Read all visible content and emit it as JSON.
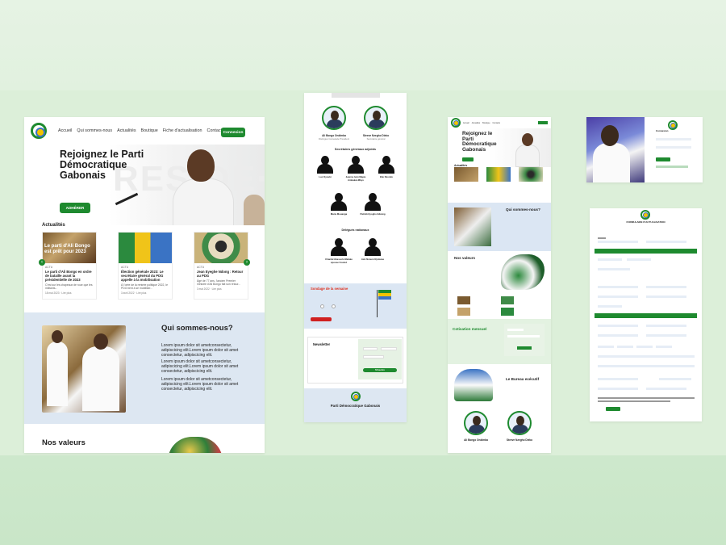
{
  "colors": {
    "brand_green": "#1e8a2f",
    "light_blue_section": "#dde7f2",
    "light_green_section": "#e3f2e1",
    "background": "#dcefd9"
  },
  "main": {
    "nav": {
      "links": [
        "Accueil",
        "Qui sommes-nous",
        "Actualités",
        "Boutique",
        "Fiche d'actualisation",
        "Contacts"
      ],
      "connect_label": "Connexion"
    },
    "hero": {
      "title": "Rejoignez le Parti Démocratique Gabonais",
      "cta_label": "ADHÉRER"
    },
    "news": {
      "heading": "Actualités",
      "cards": [
        {
          "overlay": "Le parti d'Ali Bongo est prêt pour 2023",
          "category": "ACTU",
          "title": "Le parti d'Ali Bongo en ordre de bataille avant la présidentielle de 2023",
          "excerpt": "C'est sur les chapeaux de roue que les militants...",
          "date": "18 mai 2023 · Lire plus"
        },
        {
          "overlay": "",
          "category": "ACTU",
          "title": "Élection générale 2023: Le secrétaire général du PDG appelle à la mobilisation",
          "excerpt": "À l'orée de la rentrée politique 2022, le PDG tient à se mobiliser...",
          "date": "3 avril 2022 · Lire plus"
        },
        {
          "overlay": "",
          "category": "ACTU",
          "title": "Jean Eyeghe Ndong : Retour au PDG",
          "excerpt": "Âgé de 77 ans, l'ancien Premier ministre d'Ali Bongo fait son retour...",
          "date": "3 mai 2022 · Lire plus"
        }
      ]
    },
    "about": {
      "title": "Qui sommes-nous?",
      "paragraphs": [
        "Lorem ipsum dolor sit ametconsectetur, adipiscicing elit.Lorem ipsum dolor sit amet consectetur, adipiscicing elit.",
        "Lorem ipsum dolor sit ametconsectetur, adipiscicing elit.Lorem ipsum dolor sit amet consectetur, adipiscicing elit.",
        "Lorem ipsum dolor sit ametconsectetur, adipiscicing elit.Lorem ipsum dolor sit amet consectetur, adipiscicing elit."
      ]
    },
    "values_title": "Nos valeurs"
  },
  "board2": {
    "leaders": [
      {
        "name": "Ali Bongo Ondimba",
        "role": "Distingué Camarade Président"
      },
      {
        "name": "Steeve Nzegho Dieko",
        "role": "Secrétaire général"
      }
    ],
    "sg_title": "Secrétaires généraux adjoints",
    "adjoints": [
      "Luc Oyoubi",
      "Jeanne Ivan Mapie Ambakat-Mbyo",
      "Elie Nzondo",
      "Marie Mouanga",
      "Patrick Eyogho Edzang"
    ],
    "delegates_title": "Délégués nationaux",
    "delegates": [
      "Chantal Abessolo Mebale épouse Foulod",
      "Aziz Nzoum Nyimane"
    ],
    "sondage_title": "Sondage de la semaine",
    "newsletter_title": "Newsletter",
    "newsletter_button": "S'inscrire",
    "footer_name": "Parti Démocratique Gabonais"
  },
  "board3": {
    "hero_title": "Rejoignez le Parti Démocratique Gabonais",
    "news_label": "Actualités",
    "about_title": "Qui sommes-nous?",
    "values_title": "Nos valeurs",
    "cotisation_title": "Cotisation mensuel",
    "bureau_title": "Le Bureau exécutif"
  },
  "board5": {
    "form_title": "FORMULAIRE D'ACTUALISATION"
  }
}
